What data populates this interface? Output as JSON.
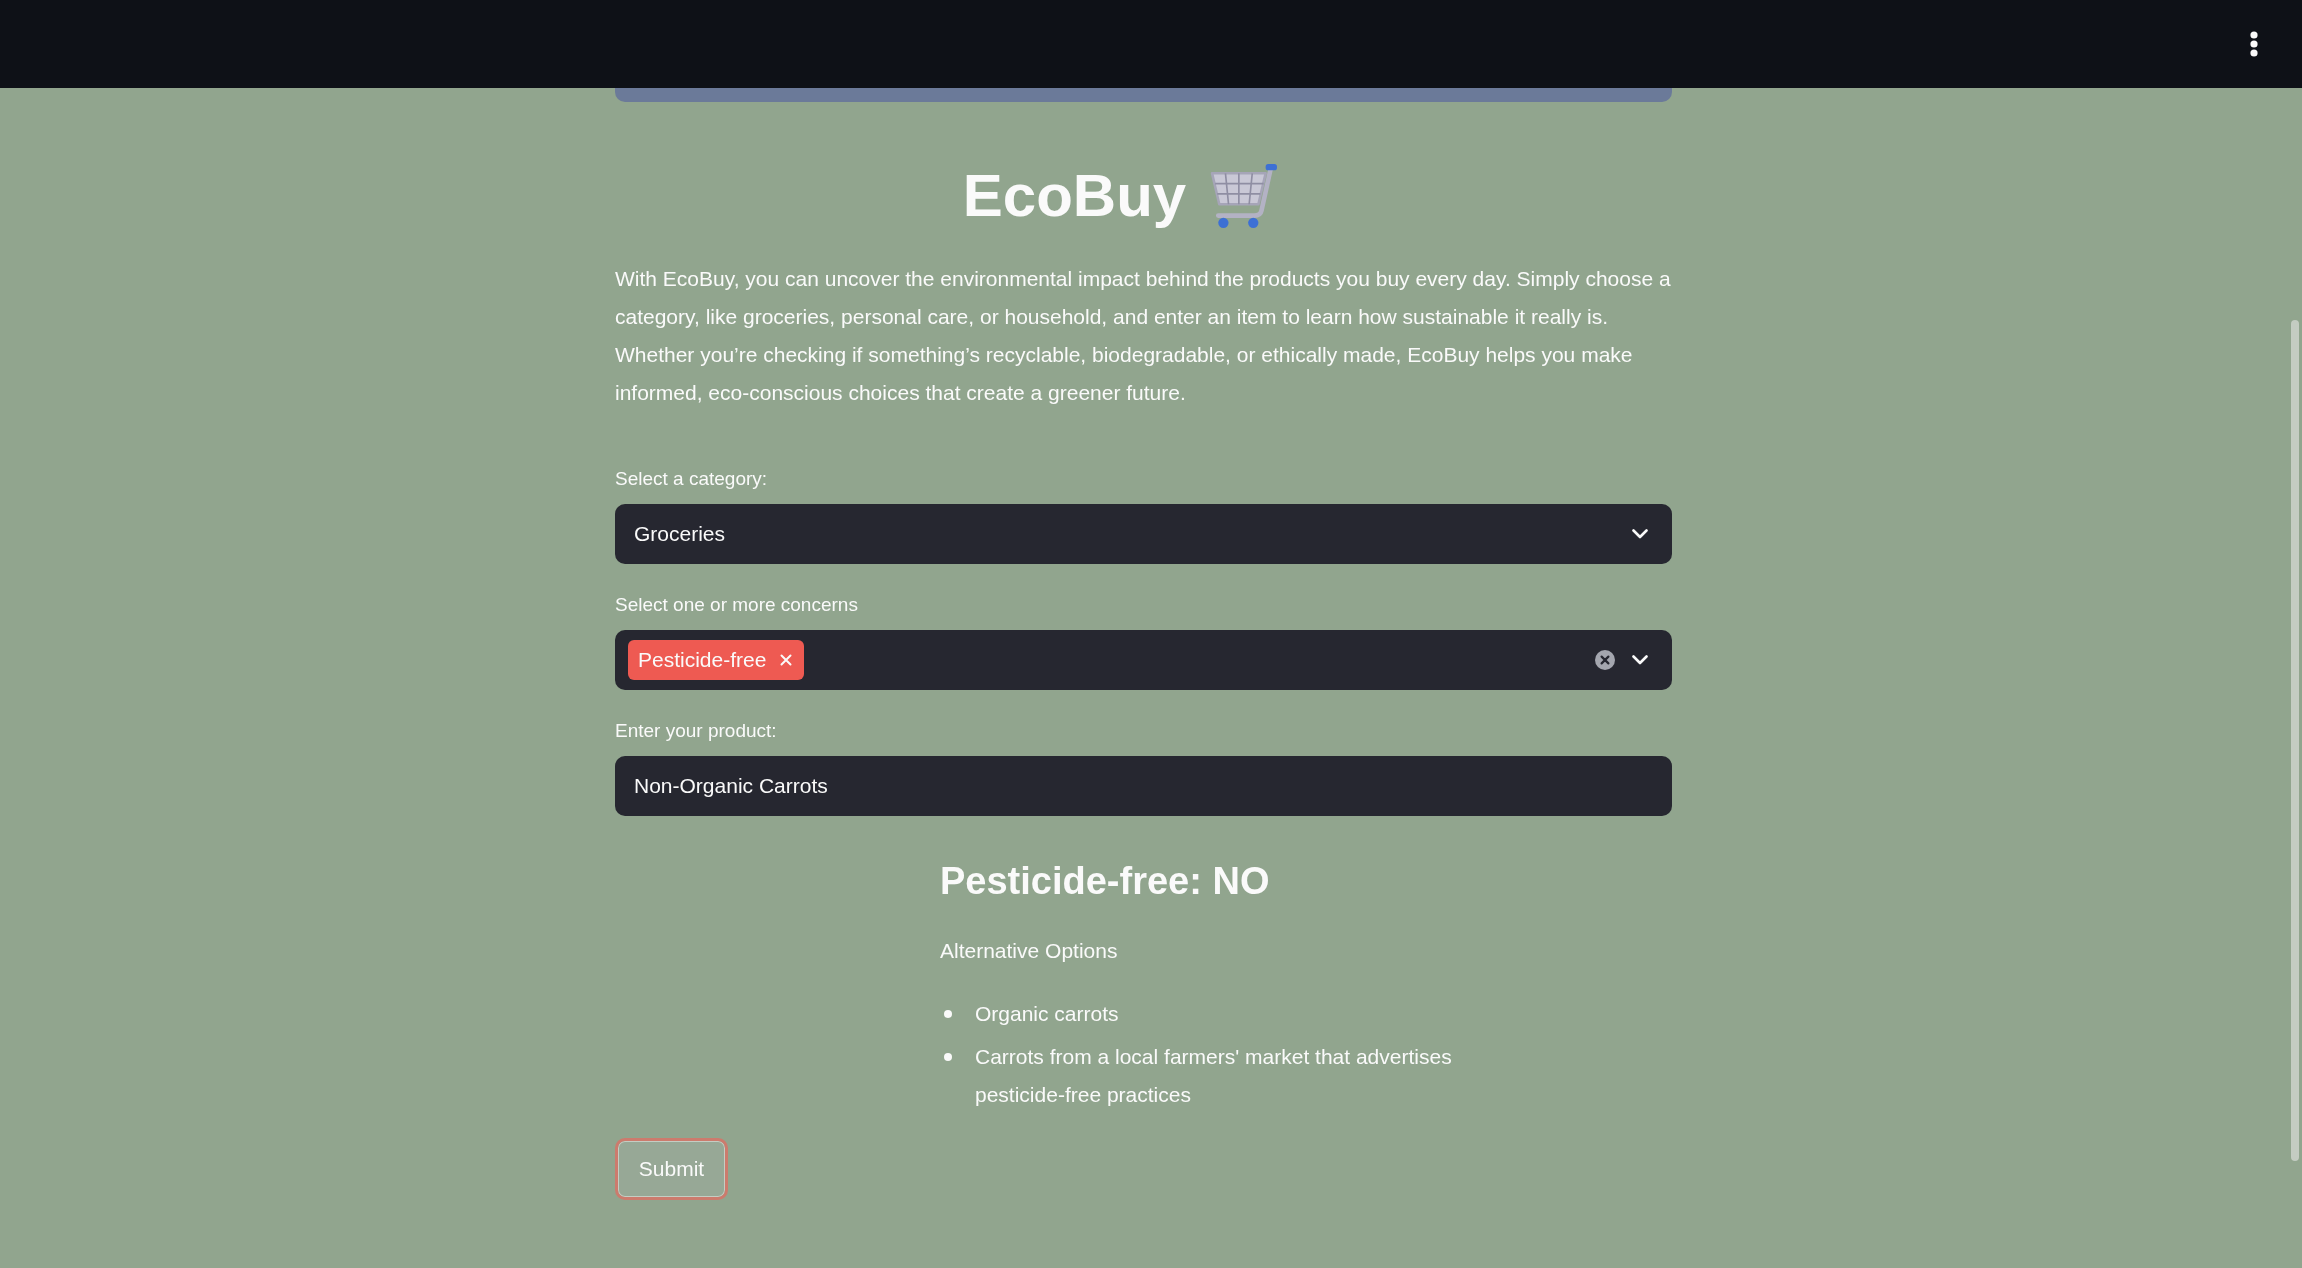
{
  "title": "EcoBuy",
  "intro": "With EcoBuy, you can uncover the environmental impact behind the products you buy every day. Simply choose a category, like groceries, personal care, or household, and enter an item to learn how sustainable it really is. Whether you’re checking if something’s recyclable, biodegradable, or ethically made, EcoBuy helps you make informed, eco-conscious choices that create a greener future.",
  "fields": [
    {
      "kind": "select",
      "label": "Select a category:",
      "value": "Groceries"
    },
    {
      "kind": "multiselect",
      "label": "Select one or more concerns",
      "tags": [
        "Pesticide-free"
      ]
    },
    {
      "kind": "text",
      "label": "Enter your product:",
      "value": "Non-Organic Carrots"
    }
  ],
  "result": {
    "heading": "Pesticide-free: NO",
    "subheading": "Alternative Options",
    "items": [
      "Organic carrots",
      "Carrots from a local farmers' market that advertises pesticide-free practices"
    ]
  },
  "submit": {
    "label": "Submit",
    "focused": true
  }
}
